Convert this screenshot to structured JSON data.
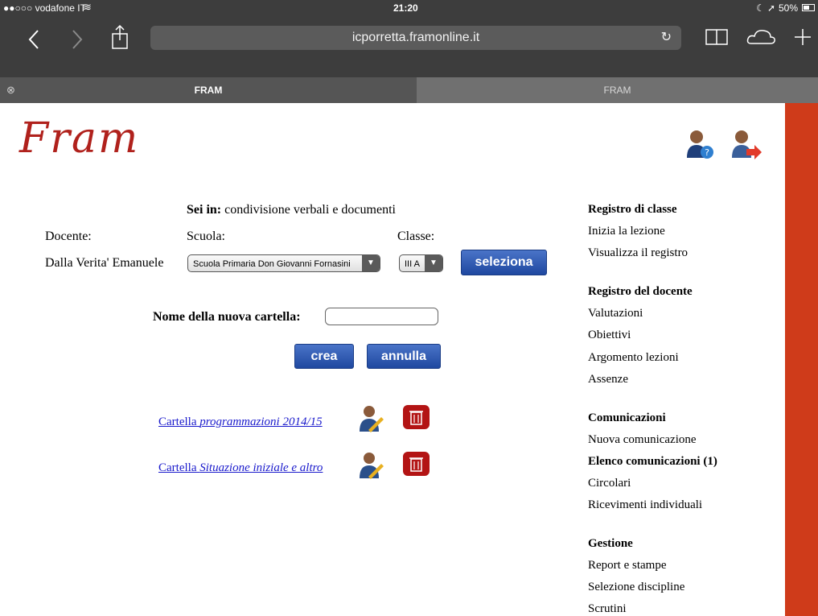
{
  "status": {
    "carrier": "●●○○○ vodafone IT",
    "time": "21:20",
    "battery": "50%"
  },
  "browser": {
    "url": "icporretta.framonline.it"
  },
  "tabs": [
    {
      "label": "FRAM"
    },
    {
      "label": "FRAM"
    }
  ],
  "page": {
    "logo": "Fram",
    "location_label": "Sei in:",
    "location_value": "condivisione verbali e documenti",
    "docente_label": "Docente:",
    "scuola_label": "Scuola:",
    "classe_label": "Classe:",
    "docente_value": "Dalla Verita' Emanuele",
    "scuola_selected": "Scuola Primaria Don Giovanni Fornasini",
    "classe_selected": "III A",
    "seleziona_label": "seleziona",
    "folder_label": "Nome della nuova cartella:",
    "folder_value": "",
    "crea_label": "crea",
    "annulla_label": "annulla",
    "folders": [
      {
        "prefix": "Cartella",
        "name": "programmazioni 2014/15"
      },
      {
        "prefix": "Cartella",
        "name": "Situazione iniziale e altro"
      }
    ]
  },
  "menu": {
    "registro_classe": {
      "title": "Registro di classe",
      "items": [
        "Inizia la lezione",
        "Visualizza il registro"
      ]
    },
    "registro_docente": {
      "title": "Registro del docente",
      "items": [
        "Valutazioni",
        "Obiettivi",
        "Argomento lezioni",
        "Assenze"
      ]
    },
    "comunicazioni": {
      "title": "Comunicazioni",
      "items": [
        "Nuova comunicazione",
        "Elenco comunicazioni (1)",
        "Circolari",
        "Ricevimenti individuali"
      ]
    },
    "gestione": {
      "title": "Gestione",
      "items": [
        "Report e stampe",
        "Selezione discipline",
        "Scrutini"
      ]
    }
  }
}
